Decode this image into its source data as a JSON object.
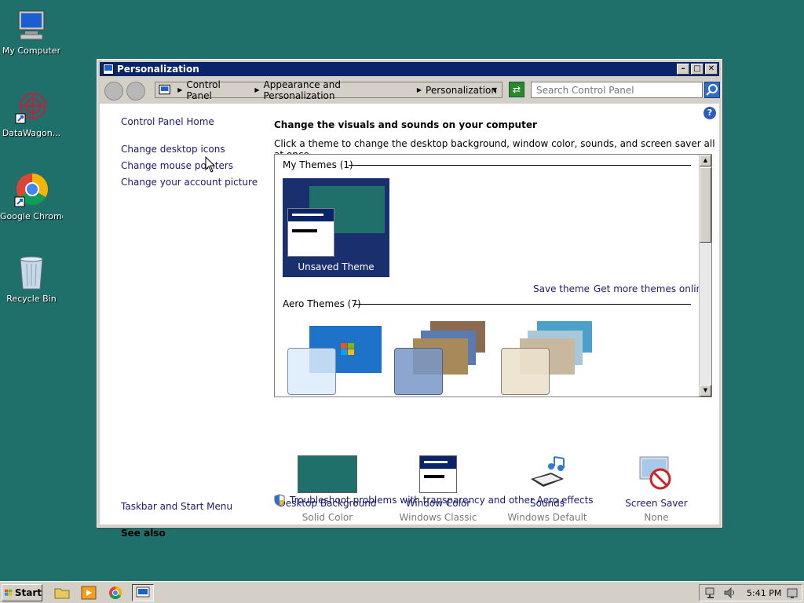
{
  "desktop": {
    "icons": [
      {
        "label": "My Computer"
      },
      {
        "label": "DataWagon..."
      },
      {
        "label": "Google Chrome"
      },
      {
        "label": "Recycle Bin"
      }
    ]
  },
  "window": {
    "title": "Personalization",
    "breadcrumb": [
      "Control Panel",
      "Appearance and Personalization",
      "Personalization"
    ],
    "search_placeholder": "Search Control Panel"
  },
  "sidebar": {
    "home": "Control Panel Home",
    "links": [
      "Change desktop icons",
      "Change mouse pointers",
      "Change your account picture"
    ],
    "see_also_title": "See also",
    "see_also_links": [
      "Taskbar and Start Menu"
    ]
  },
  "main": {
    "heading": "Change the visuals and sounds on your computer",
    "subheading": "Click a theme to change the desktop background, window color, sounds, and screen saver all at once.",
    "my_themes_label": "My Themes (1)",
    "unsaved_theme_name": "Unsaved Theme",
    "save_theme": "Save theme",
    "get_more_themes": "Get more themes online",
    "aero_themes_label": "Aero Themes (7)",
    "troubleshoot": "Troubleshoot problems with transparency and other Aero effects",
    "bottom_items": [
      {
        "title": "Desktop Background",
        "sub": "Solid Color"
      },
      {
        "title": "Window Color",
        "sub": "Windows Classic"
      },
      {
        "title": "Sounds",
        "sub": "Windows Default"
      },
      {
        "title": "Screen Saver",
        "sub": "None"
      }
    ]
  },
  "taskbar": {
    "start_label": "Start",
    "clock": "5:41 PM"
  },
  "colors": {
    "desktop": "#1f6f6a",
    "titlebar": "#0a246a",
    "link": "#1a1a6e"
  }
}
